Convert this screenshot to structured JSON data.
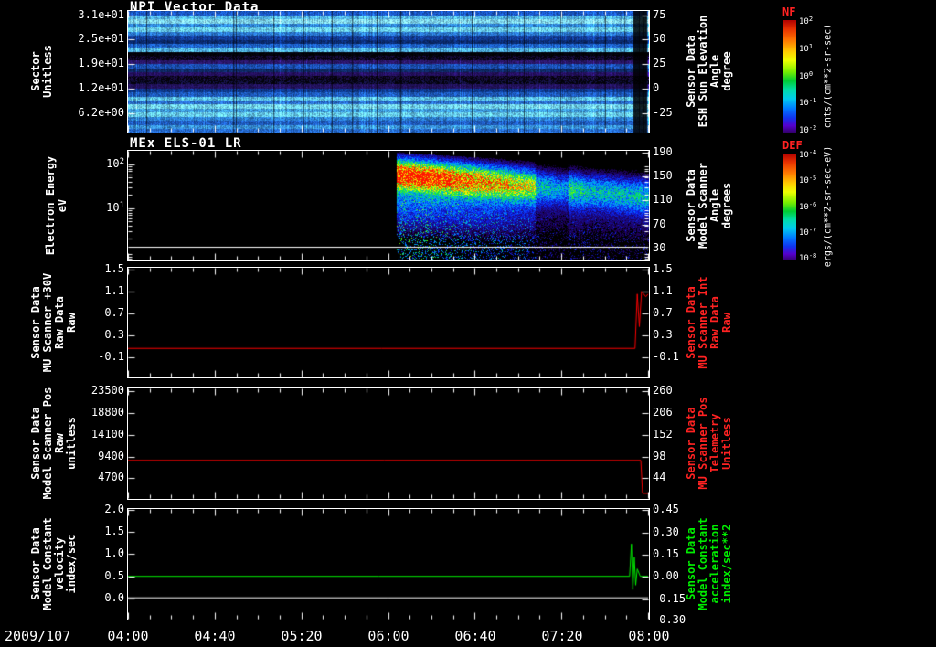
{
  "window": {
    "background": "#000000"
  },
  "x_axis": {
    "date_label": "2009/107",
    "tick_labels": [
      "04:00",
      "04:40",
      "05:20",
      "06:00",
      "06:40",
      "07:20",
      "08:00"
    ],
    "start_hour": 4.0,
    "end_hour": 8.0
  },
  "chart_data": [
    {
      "id": "npi-vector-data",
      "type": "heatmap",
      "title": "NPI Vector Data",
      "left_axis": {
        "label_lines": [
          "Sector",
          "Unitless"
        ],
        "ticks": [
          "3.1e+01",
          "2.5e+01",
          "1.9e+01",
          "1.2e+01",
          "6.2e+00"
        ],
        "color": "#ffffff"
      },
      "right_axis": {
        "label_lines": [
          "Sensor Data",
          "ESH Sun Elevation",
          "Angle",
          "degree"
        ],
        "ticks": [
          "75",
          "50",
          "25",
          "0",
          "-25"
        ],
        "color": "#ffffff"
      },
      "colorbar": {
        "label": "NF",
        "label_color": "#ff3333",
        "units": "cnts/(cm**2-sr-sec)",
        "ticks": [
          "10^2",
          "10^1",
          "10^0",
          "10^-1",
          "10^-2"
        ]
      },
      "ylim": [
        0,
        32
      ],
      "row_colors": [
        "#1a58c8",
        "#53b6ef",
        "#7fd9f7",
        "#2f86dd",
        "#66ccf2",
        "#2a78d4",
        "#123c96",
        "#0a2a6e",
        "#1d62cc",
        "#4fb2ec",
        "#050514",
        "#170a3c",
        "#2a1668",
        "#1b50b4",
        "#0e2a66",
        "#251060",
        "#190c40",
        "#131042",
        "#22125c",
        "#0e3a8e",
        "#1d5abc",
        "#5cc2ef",
        "#2a6ed0",
        "#70d4f4",
        "#3e9ce4",
        "#65caf1",
        "#2d80d6",
        "#1f5cc0",
        "#3a94e0",
        "#2468cc"
      ],
      "data_gap_interval": [
        "07:53",
        "07:59"
      ]
    },
    {
      "id": "mex-els-01-lr",
      "type": "heatmap",
      "title": "MEx ELS-01 LR",
      "left_axis": {
        "label_lines": [
          "Electron Energy",
          "eV"
        ],
        "ticks": [
          "10^2",
          "10^1"
        ],
        "color": "#ffffff"
      },
      "right_axis": {
        "label_lines": [
          "Sensor Data",
          "Model Scanner",
          "Angle",
          "degrees"
        ],
        "ticks": [
          "190",
          "150",
          "110",
          "70",
          "30"
        ],
        "color": "#ffffff"
      },
      "colorbar": {
        "label": "DEF",
        "label_color": "#ff3333",
        "units": "ergs/(cm**2-sr-sec-eV)",
        "ticks": [
          "10^-4",
          "10^-5",
          "10^-6",
          "10^-7",
          "10^-8"
        ]
      },
      "y_range_ev": [
        0.65,
        205
      ],
      "data_start_time": "06:04",
      "band": {
        "center_energy_ev_start": 60,
        "center_energy_ev_end": 21,
        "trend": "intense flux at 06:10 decaying and drifting to lower energy toward 08:00"
      },
      "reference_line_ev": 1.3
    },
    {
      "id": "mu-scanner-raw",
      "type": "line",
      "left_axis": {
        "label_lines": [
          "Sensor Data",
          "MU Scanner +30V",
          "Raw Data",
          "Raw"
        ],
        "ticks": [
          "1.5",
          "1.1",
          "0.7",
          "0.3",
          "-0.1"
        ],
        "color": "#ffffff"
      },
      "right_axis": {
        "label_lines": [
          "Sensor Data",
          "MU Scanner Int",
          "Raw Data",
          "Raw"
        ],
        "ticks": [
          "1.5",
          "1.1",
          "0.7",
          "0.3",
          "-0.1"
        ],
        "color": "#ff2222"
      },
      "ylim_left": [
        1.533,
        -0.467
      ],
      "ylim_right": [
        1.533,
        -0.467
      ],
      "series": [
        {
          "name": "mu_scanner_int",
          "color": "#ff0000",
          "axis": "right",
          "points": [
            [
              4.0,
              0.05
            ],
            [
              7.9,
              0.05
            ],
            [
              7.917,
              1.05
            ],
            [
              7.933,
              0.45
            ],
            [
              7.95,
              1.1
            ],
            [
              7.983,
              1.0
            ],
            [
              8.0,
              1.05
            ]
          ]
        }
      ]
    },
    {
      "id": "scanner-pos",
      "type": "line",
      "left_axis": {
        "label_lines": [
          "Sensor Data",
          "Model Scanner Pos",
          "Raw",
          "unitless"
        ],
        "ticks": [
          "23500",
          "18800",
          "14100",
          "9400",
          "4700"
        ],
        "color": "#ffffff"
      },
      "right_axis": {
        "label_lines": [
          "Sensor Data",
          "MU Scanner Pos",
          "Telemetry",
          "Unitless"
        ],
        "ticks": [
          "260",
          "206",
          "152",
          "98",
          "44"
        ],
        "color": "#ff2222"
      },
      "ylim_left": [
        24090,
        390
      ],
      "ylim_right": [
        266.9,
        -5.6
      ],
      "series": [
        {
          "name": "mu_scanner_pos",
          "color": "#ff0000",
          "axis": "right",
          "points": [
            [
              4.0,
              88
            ],
            [
              7.944,
              88
            ],
            [
              7.958,
              6
            ],
            [
              8.0,
              6
            ]
          ]
        }
      ]
    },
    {
      "id": "model-constant",
      "type": "line",
      "left_axis": {
        "label_lines": [
          "Sensor Data",
          "Model Constant",
          "velocity",
          "index/sec"
        ],
        "ticks": [
          "2.0",
          "1.5",
          "1.0",
          "0.5",
          "0.0"
        ],
        "color": "#ffffff"
      },
      "right_axis": {
        "label_lines": [
          "Sensor Data",
          "Model Constant",
          "acceleration",
          "index/sec**2"
        ],
        "ticks": [
          "0.45",
          "0.30",
          "0.15",
          "0.00",
          "-0.15",
          "-0.30"
        ],
        "color": "#00ee00"
      },
      "ylim_left": [
        2.02,
        -0.474
      ],
      "ylim_right": [
        0.4575,
        -0.2877
      ],
      "series": [
        {
          "name": "velocity",
          "color": "#ffffff",
          "axis": "left",
          "points": [
            [
              4.0,
              0.0
            ],
            [
              8.0,
              0.0
            ]
          ]
        },
        {
          "name": "acceleration",
          "color": "#00ee00",
          "axis": "right",
          "points": [
            [
              4.0,
              0.0
            ],
            [
              7.858,
              0.0
            ],
            [
              7.872,
              0.22
            ],
            [
              7.883,
              -0.09
            ],
            [
              7.894,
              0.13
            ],
            [
              7.905,
              -0.06
            ],
            [
              7.917,
              0.05
            ],
            [
              7.94,
              0.0
            ],
            [
              8.0,
              0.0
            ]
          ]
        }
      ]
    }
  ]
}
